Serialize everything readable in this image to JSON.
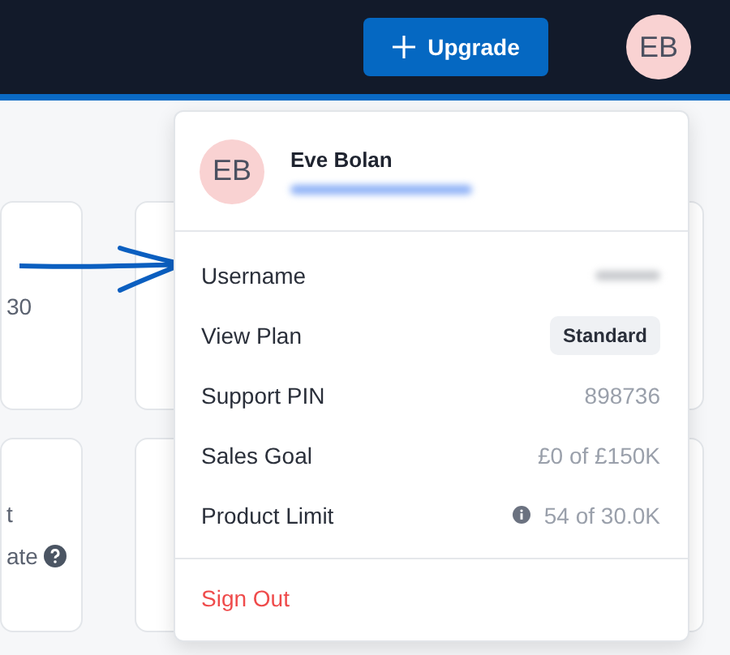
{
  "header": {
    "upgrade_button": "Upgrade",
    "avatar": "EB"
  },
  "background_cards": [
    {
      "texts": [
        "30"
      ]
    },
    {
      "texts": [
        "t",
        "ate"
      ],
      "help": true
    }
  ],
  "account_menu": {
    "avatar": "EB",
    "name": "Eve Bolan",
    "email_redacted": true,
    "rows": [
      {
        "kind": "redacted",
        "label": "Username"
      },
      {
        "kind": "badge",
        "label": "View Plan",
        "value": "Standard"
      },
      {
        "kind": "text",
        "label": "Support PIN",
        "value": "898736"
      },
      {
        "kind": "text",
        "label": "Sales Goal",
        "value": "£0 of £150K"
      },
      {
        "kind": "info",
        "label": "Product Limit",
        "value": "54 of 30.0K"
      }
    ],
    "sign_out": "Sign Out"
  }
}
